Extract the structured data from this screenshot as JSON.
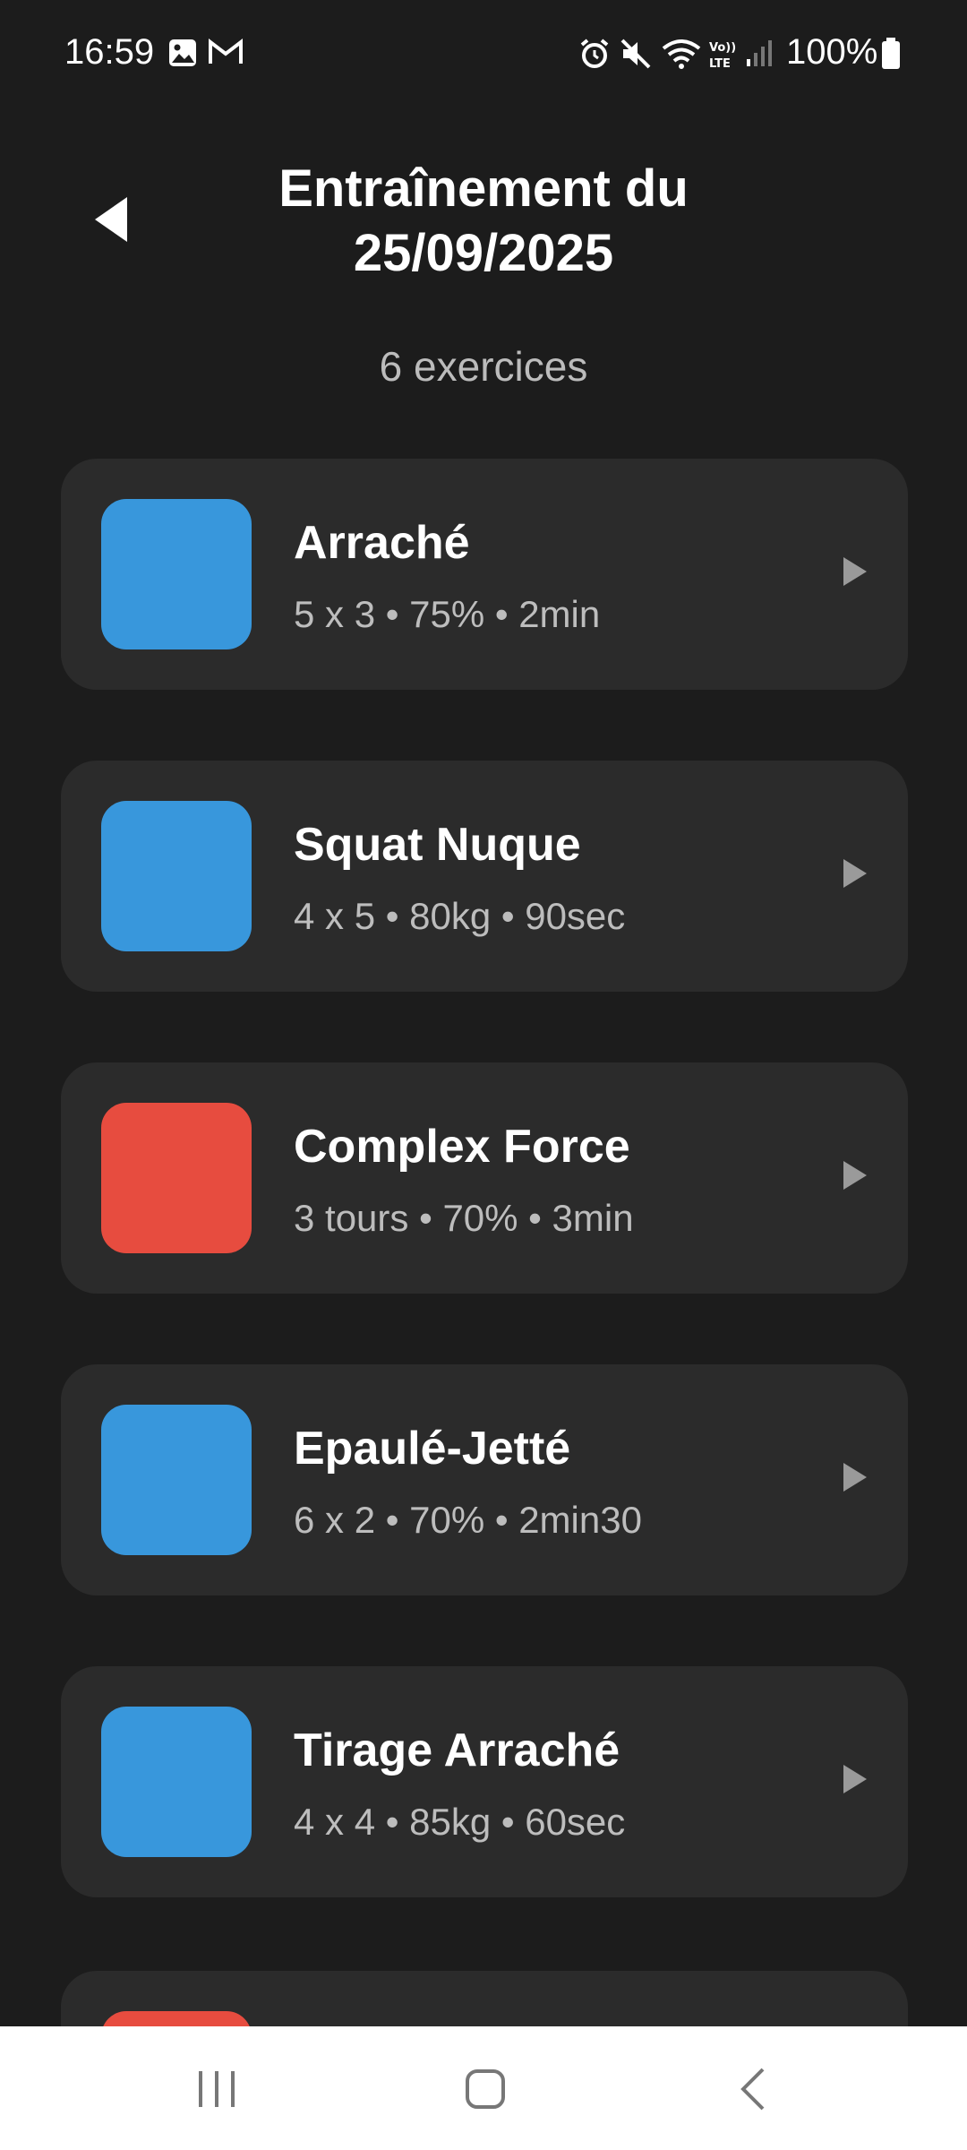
{
  "status_bar": {
    "time": "16:59",
    "battery": "100%"
  },
  "header": {
    "title": "Entraînement du 25/09/2025",
    "subtitle": "6 exercices"
  },
  "exercises": [
    {
      "name": "Arraché",
      "detail": "5 x 3 • 75% • 2min",
      "color": "#3897dc"
    },
    {
      "name": "Squat Nuque",
      "detail": "4 x 5 • 80kg • 90sec",
      "color": "#3897dc"
    },
    {
      "name": "Complex Force",
      "detail": "3 tours • 70% • 3min",
      "color": "#e74c3f"
    },
    {
      "name": "Epaulé-Jetté",
      "detail": "6 x 2 • 70% • 2min30",
      "color": "#3897dc"
    },
    {
      "name": "Tirage Arraché",
      "detail": "4 x 4 • 85kg • 60sec",
      "color": "#3897dc"
    },
    {
      "name": "",
      "detail": "",
      "color": "#e74c3f"
    }
  ],
  "icons": {
    "back": "back-arrow-icon",
    "play": "play-triangle-icon",
    "nav_recents": "recents-icon",
    "nav_home": "home-icon",
    "nav_back": "nav-back-icon"
  },
  "colors": {
    "background": "#1c1c1c",
    "card": "#2b2b2b",
    "blue": "#3897dc",
    "red": "#e74c3f"
  }
}
